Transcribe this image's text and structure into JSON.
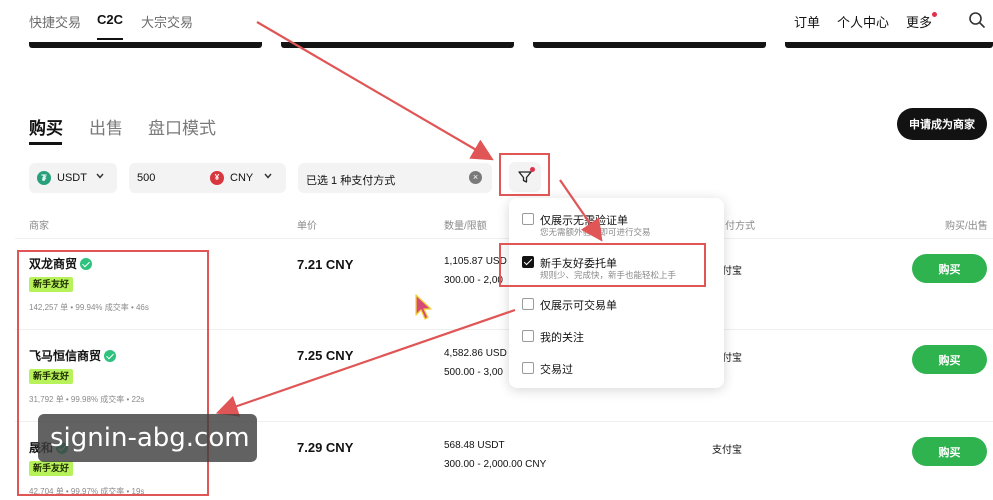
{
  "nav": {
    "left": [
      "快捷交易",
      "C2C",
      "大宗交易"
    ],
    "right": [
      "订单",
      "个人中心",
      "更多"
    ]
  },
  "tabs": [
    "购买",
    "出售",
    "盘口模式"
  ],
  "merchant_button": "申请成为商家",
  "filters": {
    "coin": "USDT",
    "amount": "500",
    "currency": "CNY",
    "payment": "已选 1 种支付方式"
  },
  "table_header": {
    "merchant": "商家",
    "price": "单价",
    "amount": "数量/限额",
    "payment": "付方式",
    "action": "购买/出售"
  },
  "rows": [
    {
      "name": "双龙商贸",
      "badge": "新手友好",
      "stats": "142,257 单  •  99.94% 成交率  •  46s",
      "price": "7.21 CNY",
      "qty": "1,105.87 USD",
      "limit": "300.00 - 2,00",
      "pay": "支付宝",
      "buy": "购买"
    },
    {
      "name": "飞马恒信商贸",
      "badge": "新手友好",
      "stats": "31,792 单  •  99.98% 成交率  •  22s",
      "price": "7.25 CNY",
      "qty": "4,582.86 USD",
      "limit": "500.00 - 3,00",
      "pay": "支付宝",
      "buy": "购买"
    },
    {
      "name": "晟和",
      "badge": "新手友好",
      "stats": "42,704 单  •  99.97% 成交率  •  19s",
      "price": "7.29 CNY",
      "qty": "568.48 USDT",
      "limit": "300.00 - 2,000.00 CNY",
      "pay": "支付宝",
      "buy": "购买"
    }
  ],
  "dropdown": [
    {
      "label": "仅展示无需验证单",
      "desc": "您无需额外验证即可进行交易",
      "checked": false
    },
    {
      "label": "新手友好委托单",
      "desc": "规则少、完成快，新手也能轻松上手",
      "checked": true
    },
    {
      "label": "仅展示可交易单",
      "desc": "",
      "checked": false
    },
    {
      "label": "我的关注",
      "desc": "",
      "checked": false
    },
    {
      "label": "交易过",
      "desc": "",
      "checked": false
    }
  ],
  "watermark": "signin-abg.com",
  "colors": {
    "buy_green": "#2fb34f",
    "badge_green": "#b7f25a",
    "annotation_red": "#e05555"
  }
}
